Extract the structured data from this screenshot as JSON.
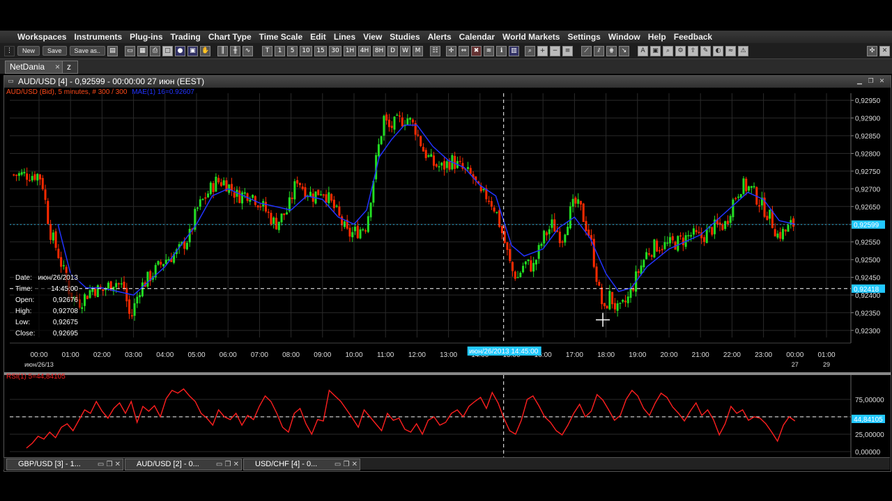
{
  "menu": [
    "Workspaces",
    "Instruments",
    "Plug-ins",
    "Trading",
    "Chart Type",
    "Time Scale",
    "Edit",
    "Lines",
    "View",
    "Studies",
    "Alerts",
    "Calendar",
    "World Markets",
    "Settings",
    "Window",
    "Help",
    "Feedback"
  ],
  "toolbar": {
    "new_label": "New",
    "save_label": "Save",
    "save_as_label": "Save as..",
    "timeframes": [
      "T",
      "1",
      "5",
      "10",
      "15",
      "30",
      "1H",
      "4H",
      "8H",
      "D",
      "W",
      "M"
    ]
  },
  "tabs": {
    "main": "NetDania",
    "close_glyph": "×",
    "second": "z"
  },
  "window": {
    "title": "AUD/USD [4] - 0,92599 - 00:00:00 27 июн (EEST)"
  },
  "legend": {
    "price": "AUD/USD (Bid), 5 minutes, # 300 / 300",
    "ma": "MAE(1) 16=0.92607",
    "rsi": "RSI(1) 5=44,84105"
  },
  "info": {
    "rows": [
      {
        "label": "Date:",
        "value": "июн/26/2013"
      },
      {
        "label": "Time:",
        "value": "14:45:00"
      },
      {
        "label": "Open:",
        "value": "0,92676"
      },
      {
        "label": "High:",
        "value": "0,92708"
      },
      {
        "label": "Low:",
        "value": "0,92675"
      },
      {
        "label": "Close:",
        "value": "0,92695"
      }
    ]
  },
  "colors": {
    "up": "#22dd22",
    "down": "#ff2a00",
    "ma": "#2233ff",
    "rsi": "#ff1f1f",
    "accent": "#22c8ff",
    "legend_price": "#ff4a1a"
  },
  "crosshair": {
    "time_label": "июн/26/2013 14:45:00",
    "price_label": "0,92418",
    "rsi_label": "44,84105"
  },
  "current_price_label": "0,92599",
  "chart_data": [
    {
      "type": "candlestick",
      "title": "AUD/USD (Bid), 5 minutes, # 300 / 300",
      "x_tick_labels": [
        "00:00",
        "01:00",
        "02:00",
        "03:00",
        "04:00",
        "05:00",
        "06:00",
        "07:00",
        "08:00",
        "09:00",
        "10:00",
        "11:00",
        "12:00",
        "13:00",
        "14:00",
        "15:00",
        "16:00",
        "17:00",
        "18:00",
        "19:00",
        "20:00",
        "21:00",
        "22:00",
        "23:00",
        "00:00",
        "01:00"
      ],
      "x_sub_labels": [
        "июн/26/13",
        "27",
        "29"
      ],
      "y_tick_labels": [
        "0,92950",
        "0,92900",
        "0,92850",
        "0,92800",
        "0,92750",
        "0,92700",
        "0,92650",
        "0,92600",
        "0,92550",
        "0,92500",
        "0,92450",
        "0,92400",
        "0,92350",
        "0,92300"
      ],
      "ylim": [
        0.9228,
        0.9297
      ],
      "close_path": [
        [
          0.0,
          0.9274
        ],
        [
          0.1,
          0.9272
        ],
        [
          0.35,
          0.9258
        ],
        [
          0.6,
          0.9252
        ],
        [
          1.0,
          0.924
        ],
        [
          1.3,
          0.9238
        ],
        [
          1.7,
          0.9242
        ],
        [
          2.0,
          0.9241
        ],
        [
          2.4,
          0.9244
        ],
        [
          2.7,
          0.9242
        ],
        [
          2.9,
          0.9233
        ],
        [
          3.2,
          0.9242
        ],
        [
          3.6,
          0.9246
        ],
        [
          4.0,
          0.925
        ],
        [
          4.4,
          0.9252
        ],
        [
          4.8,
          0.9257
        ],
        [
          5.0,
          0.9264
        ],
        [
          5.3,
          0.9268
        ],
        [
          5.6,
          0.9272
        ],
        [
          5.9,
          0.9272
        ],
        [
          6.3,
          0.9268
        ],
        [
          6.7,
          0.9269
        ],
        [
          7.1,
          0.9265
        ],
        [
          7.5,
          0.926
        ],
        [
          7.9,
          0.9264
        ],
        [
          8.2,
          0.9273
        ],
        [
          8.4,
          0.927
        ],
        [
          8.7,
          0.9268
        ],
        [
          9.0,
          0.927
        ],
        [
          9.4,
          0.9264
        ],
        [
          9.8,
          0.9257
        ],
        [
          10.1,
          0.9258
        ],
        [
          10.4,
          0.926
        ],
        [
          10.7,
          0.9278
        ],
        [
          10.95,
          0.929
        ],
        [
          11.1,
          0.9287
        ],
        [
          11.4,
          0.9289
        ],
        [
          11.7,
          0.929
        ],
        [
          11.95,
          0.9287
        ],
        [
          12.2,
          0.9281
        ],
        [
          12.5,
          0.9277
        ],
        [
          12.8,
          0.9276
        ],
        [
          13.1,
          0.9278
        ],
        [
          13.5,
          0.9275
        ],
        [
          13.8,
          0.9273
        ],
        [
          14.0,
          0.9268
        ],
        [
          14.25,
          0.9268
        ],
        [
          14.5,
          0.9264
        ],
        [
          14.75,
          0.9256
        ],
        [
          15.0,
          0.9247
        ],
        [
          15.2,
          0.9245
        ],
        [
          15.4,
          0.9249
        ],
        [
          15.7,
          0.9248
        ],
        [
          16.0,
          0.9256
        ],
        [
          16.3,
          0.926
        ],
        [
          16.6,
          0.9256
        ],
        [
          16.8,
          0.9262
        ],
        [
          17.0,
          0.9266
        ],
        [
          17.2,
          0.9264
        ],
        [
          17.5,
          0.9256
        ],
        [
          17.8,
          0.924
        ],
        [
          17.95,
          0.9235
        ],
        [
          18.1,
          0.924
        ],
        [
          18.4,
          0.9235
        ],
        [
          18.7,
          0.9239
        ],
        [
          19.0,
          0.9246
        ],
        [
          19.3,
          0.9252
        ],
        [
          19.6,
          0.9254
        ],
        [
          19.9,
          0.9254
        ],
        [
          20.3,
          0.9255
        ],
        [
          20.7,
          0.9257
        ],
        [
          21.0,
          0.9256
        ],
        [
          21.4,
          0.9259
        ],
        [
          21.8,
          0.926
        ],
        [
          22.0,
          0.9266
        ],
        [
          22.3,
          0.9271
        ],
        [
          22.6,
          0.927
        ],
        [
          22.9,
          0.9266
        ],
        [
          23.2,
          0.9262
        ],
        [
          23.45,
          0.9257
        ],
        [
          23.7,
          0.9258
        ],
        [
          23.9,
          0.926
        ],
        [
          24.0,
          0.92599
        ]
      ],
      "ma_path": [
        [
          0.6,
          0.926
        ],
        [
          1.0,
          0.9246
        ],
        [
          1.5,
          0.9242
        ],
        [
          2.0,
          0.9242
        ],
        [
          3.0,
          0.924
        ],
        [
          4.0,
          0.9248
        ],
        [
          5.0,
          0.926
        ],
        [
          5.5,
          0.9268
        ],
        [
          6.0,
          0.927
        ],
        [
          7.0,
          0.9266
        ],
        [
          8.0,
          0.9264
        ],
        [
          8.5,
          0.9268
        ],
        [
          9.0,
          0.9267
        ],
        [
          9.5,
          0.9262
        ],
        [
          10.0,
          0.926
        ],
        [
          10.4,
          0.9264
        ],
        [
          10.8,
          0.9279
        ],
        [
          11.2,
          0.9284
        ],
        [
          11.6,
          0.9288
        ],
        [
          12.0,
          0.9288
        ],
        [
          12.5,
          0.9282
        ],
        [
          13.0,
          0.9278
        ],
        [
          13.5,
          0.9276
        ],
        [
          14.0,
          0.9271
        ],
        [
          14.5,
          0.9268
        ],
        [
          15.0,
          0.9254
        ],
        [
          15.4,
          0.9251
        ],
        [
          16.0,
          0.9253
        ],
        [
          16.5,
          0.9259
        ],
        [
          17.0,
          0.9262
        ],
        [
          17.5,
          0.9256
        ],
        [
          18.0,
          0.9246
        ],
        [
          18.4,
          0.9241
        ],
        [
          18.8,
          0.9242
        ],
        [
          19.3,
          0.9248
        ],
        [
          20.0,
          0.9253
        ],
        [
          21.0,
          0.9257
        ],
        [
          22.0,
          0.9265
        ],
        [
          22.5,
          0.9269
        ],
        [
          23.0,
          0.9267
        ],
        [
          23.5,
          0.9261
        ],
        [
          24.0,
          0.926
        ]
      ],
      "crosshair_x": 14.75,
      "crosshair_y": 0.92418
    },
    {
      "type": "line",
      "title": "RSI(1) 5=44,84105",
      "y_tick_labels": [
        "75,00000",
        "50,00000",
        "25,00000",
        "0,00000"
      ],
      "ylim": [
        0,
        100
      ],
      "rsi_levels": [
        5,
        12,
        22,
        18,
        28,
        20,
        35,
        40,
        30,
        45,
        60,
        55,
        72,
        58,
        48,
        62,
        70,
        55,
        72,
        42,
        65,
        58,
        66,
        50,
        76,
        88,
        84,
        90,
        80,
        72,
        55,
        48,
        38,
        60,
        50,
        46,
        55,
        38,
        52,
        46,
        65,
        80,
        72,
        55,
        35,
        28,
        55,
        62,
        40,
        25,
        46,
        44,
        88,
        80,
        72,
        60,
        48,
        35,
        60,
        50,
        40,
        30,
        55,
        45,
        48,
        32,
        28,
        40,
        25,
        45,
        50,
        38,
        42,
        55,
        60,
        50,
        65,
        72,
        78,
        62,
        85,
        70,
        48,
        30,
        25,
        45,
        75,
        80,
        66,
        50,
        42,
        30,
        24,
        38,
        55,
        68,
        50,
        58,
        82,
        74,
        60,
        45,
        52,
        75,
        88,
        80,
        62,
        52,
        70,
        84,
        78,
        64,
        55,
        44,
        58,
        70,
        52,
        60,
        46,
        24,
        40,
        65,
        55,
        60,
        45,
        50,
        48,
        40,
        28,
        15,
        38,
        50,
        44
      ]
    }
  ],
  "bottom_tabs": [
    "GBP/USD [3] - 1...",
    "AUD/USD [2] - 0...",
    "USD/CHF [4] - 0..."
  ]
}
